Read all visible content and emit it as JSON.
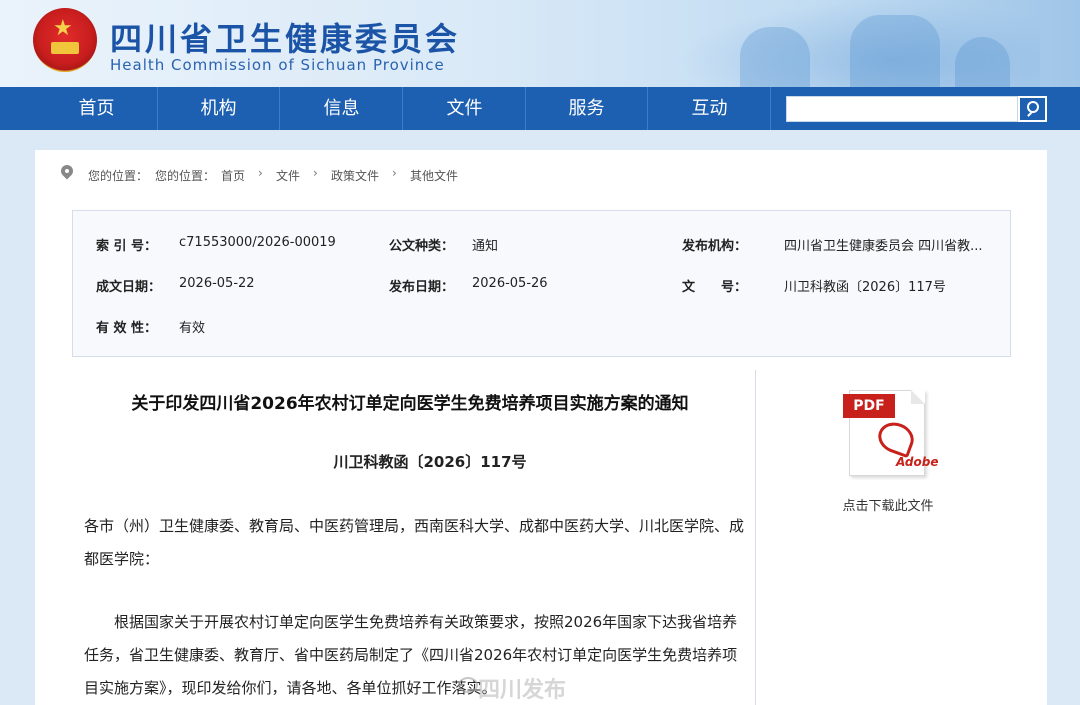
{
  "header": {
    "title_cn": "四川省卫生健康委员会",
    "title_en": "Health Commission of Sichuan Province"
  },
  "nav": {
    "items": [
      "首页",
      "机构",
      "信息",
      "文件",
      "服务",
      "互动"
    ],
    "search_placeholder": ""
  },
  "breadcrumb": {
    "prefix1": "您的位置：",
    "prefix2": "您的位置：",
    "items": [
      "首页",
      "文件",
      "政策文件",
      "其他文件"
    ]
  },
  "meta": {
    "index_label": "索 引 号：",
    "index_value": "c71553000/2026-00019",
    "type_label": "公文种类：",
    "type_value": "通知",
    "publisher_label": "发布机构：",
    "publisher_value": "四川省卫生健康委员会 四川省教...",
    "written_label": "成文日期：",
    "written_value": "2026-05-22",
    "published_label": "发布日期：",
    "published_value": "2026-05-26",
    "docno_label": "文　　号：",
    "docno_value": "川卫科教函〔2026〕117号",
    "valid_label": "有 效 性：",
    "valid_value": "有效"
  },
  "document": {
    "title": "关于印发四川省2026年农村订单定向医学生免费培养项目实施方案的通知",
    "number": "川卫科教函〔2026〕117号",
    "recipients": "各市（州）卫生健康委、教育局、中医药管理局，西南医科大学、成都中医药大学、川北医学院、成都医学院：",
    "body": "根据国家关于开展农村订单定向医学生免费培养有关政策要求，按照2026年国家下达我省培养任务，省卫生健康委、教育厅、省中医药局制定了《四川省2026年农村订单定向医学生免费培养项目实施方案》，现印发给你们，请各地、各单位抓好工作落实。"
  },
  "attachment": {
    "icon_tag": "PDF",
    "icon_brand": "Adobe",
    "caption": "点击下载此文件"
  },
  "watermark": "四川发布"
}
